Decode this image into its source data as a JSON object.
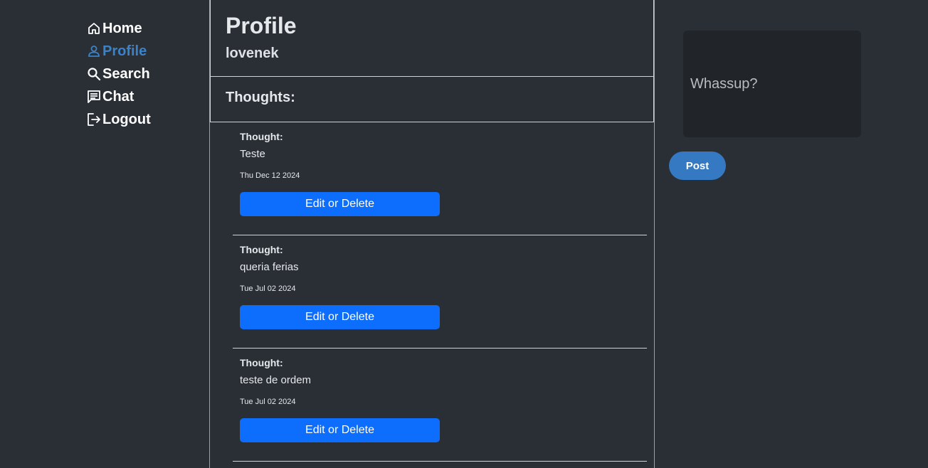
{
  "nav": {
    "items": [
      {
        "label": "Home",
        "icon": "home-icon",
        "active": false
      },
      {
        "label": "Profile",
        "icon": "person-icon",
        "active": true
      },
      {
        "label": "Search",
        "icon": "search-icon",
        "active": false
      },
      {
        "label": "Chat",
        "icon": "chat-icon",
        "active": false
      },
      {
        "label": "Logout",
        "icon": "logout-icon",
        "active": false
      }
    ]
  },
  "profile": {
    "title": "Profile",
    "username": "lovenek"
  },
  "thoughts": {
    "heading": "Thoughts:",
    "items": [
      {
        "label": "Thought:",
        "text": "Teste",
        "date": "Thu Dec 12 2024",
        "button": "Edit or Delete"
      },
      {
        "label": "Thought:",
        "text": "queria ferias",
        "date": "Tue Jul 02 2024",
        "button": "Edit or Delete"
      },
      {
        "label": "Thought:",
        "text": "teste de ordem",
        "date": "Tue Jul 02 2024",
        "button": "Edit or Delete"
      }
    ]
  },
  "compose": {
    "placeholder": "Whassup?",
    "post_label": "Post"
  },
  "colors": {
    "background": "#2a2f35",
    "active_nav": "#3b82c8",
    "primary_button": "#0d6efd",
    "post_button": "#3479c2"
  }
}
